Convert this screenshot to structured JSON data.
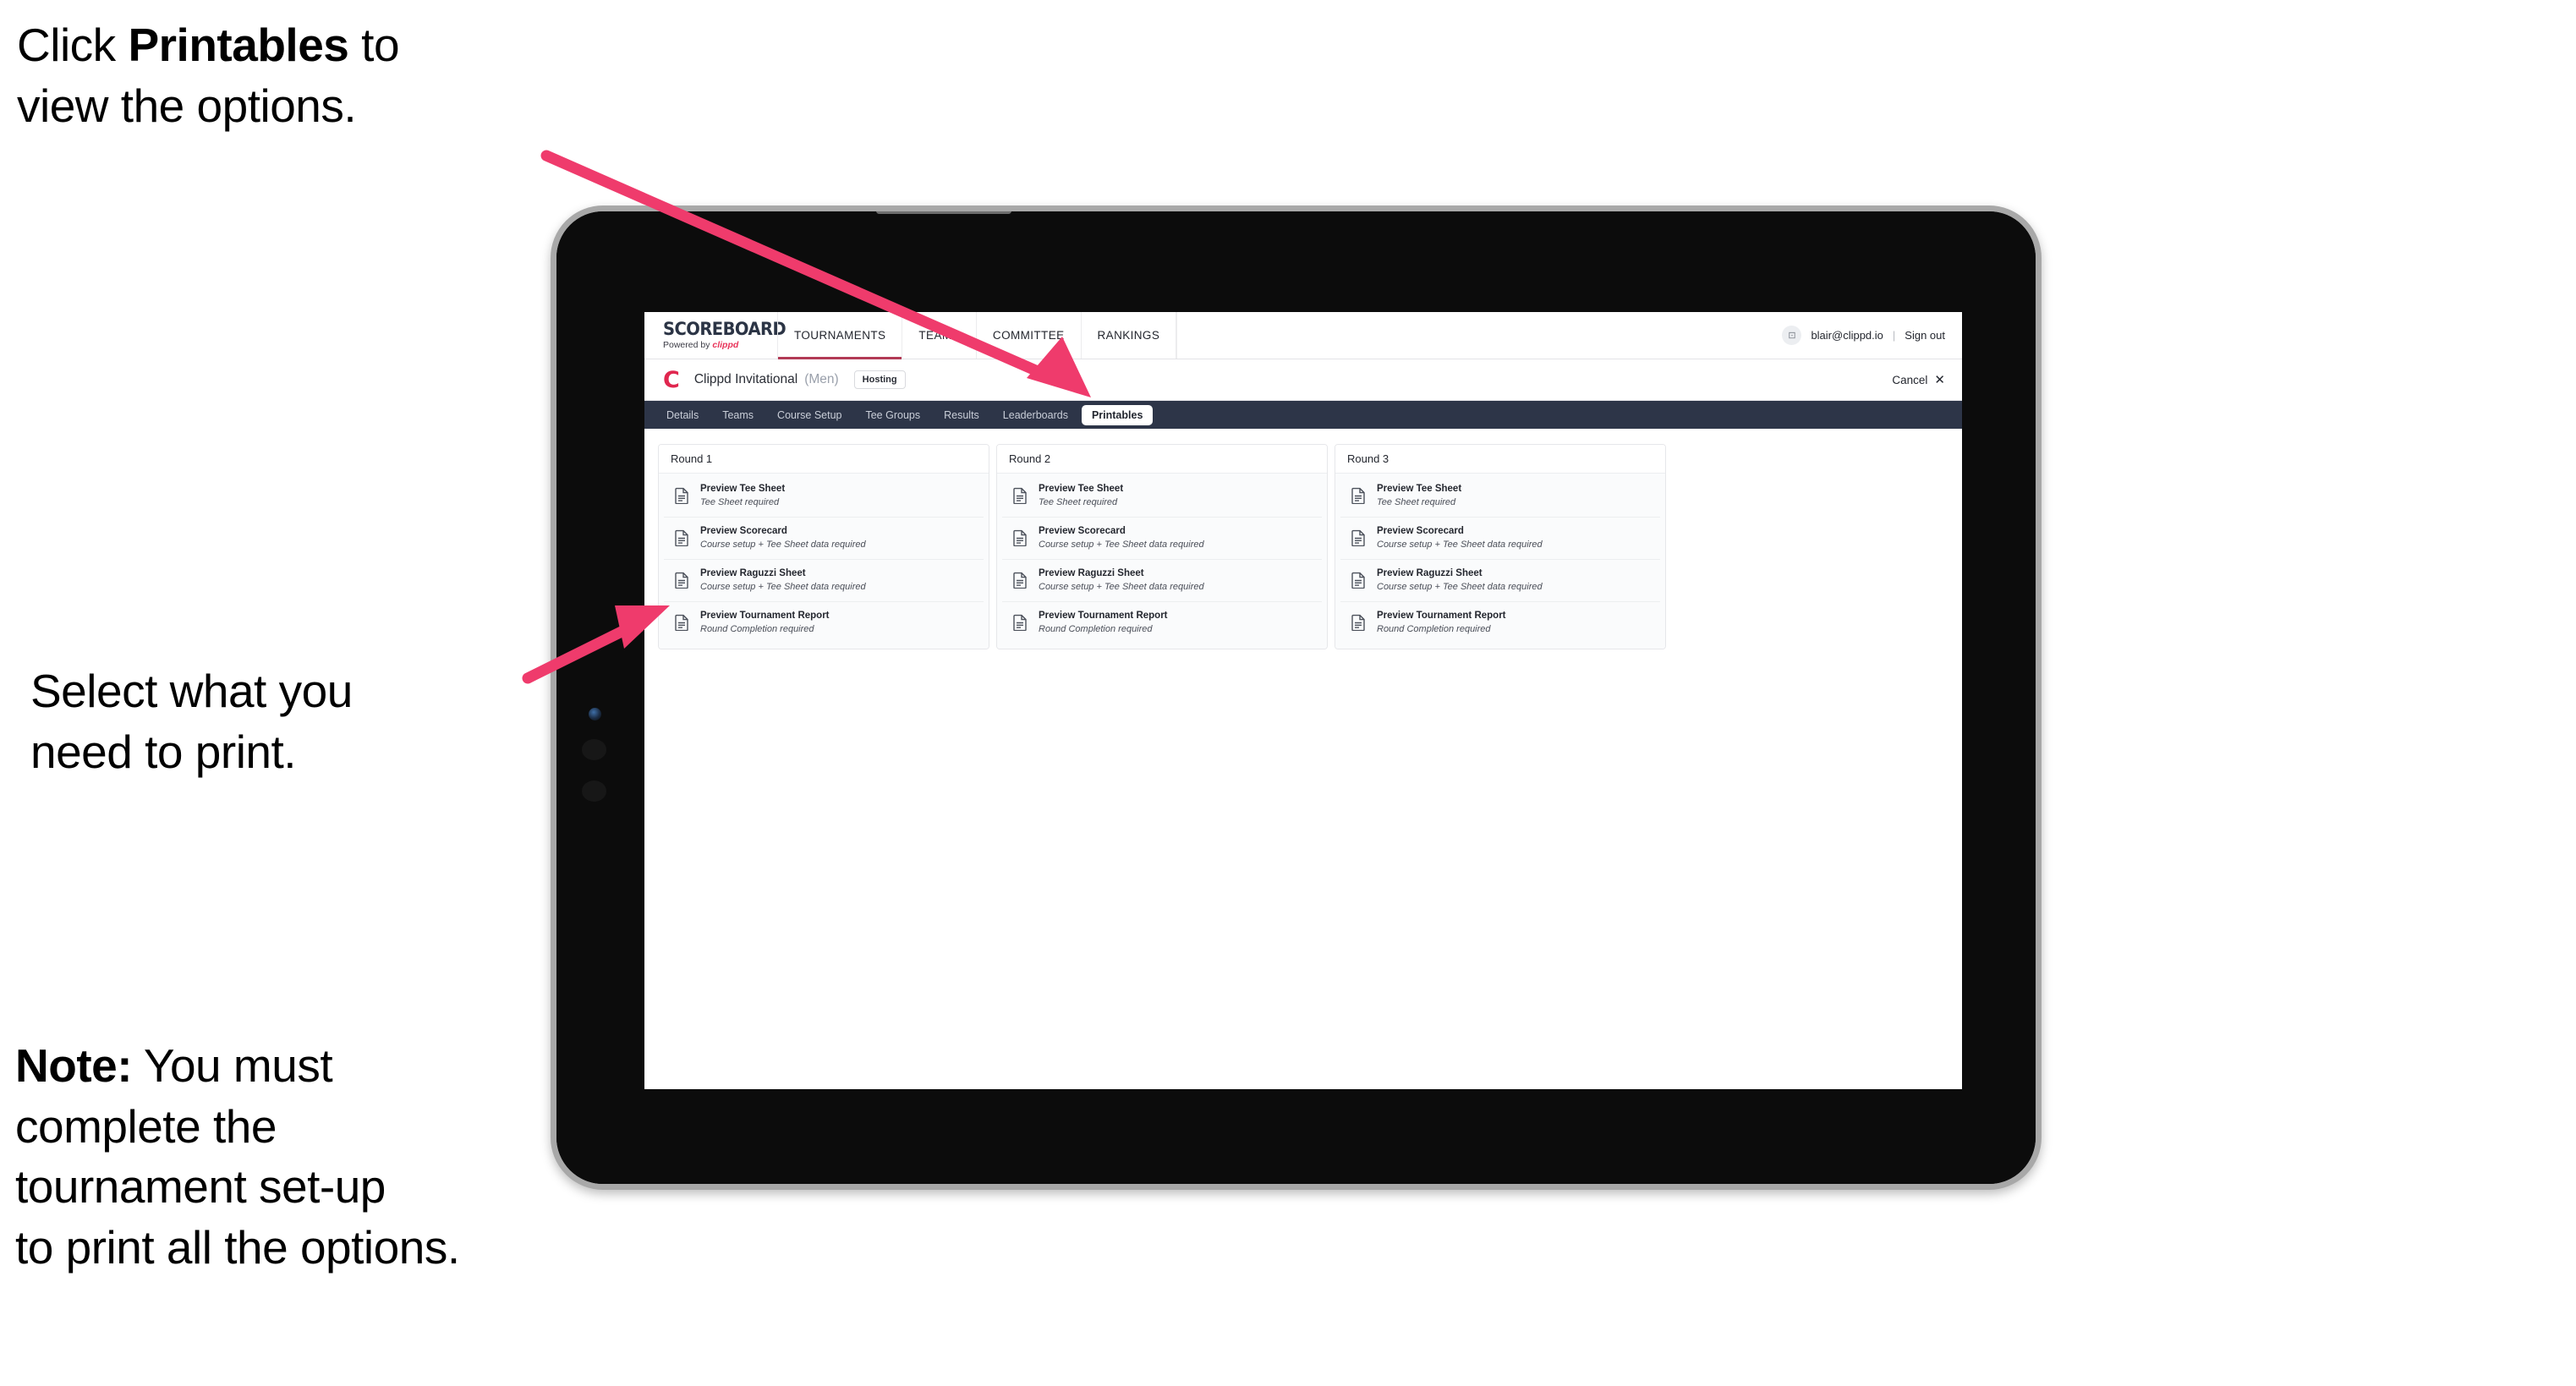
{
  "annotations": {
    "a1_pre": "Click ",
    "a1_bold": "Printables",
    "a1_post": " to\nview the options.",
    "a2": "Select what you\n need to print.",
    "a3_bold": "Note:",
    "a3_post": " You must\ncomplete the\ntournament set-up\nto print all the options."
  },
  "colors": {
    "accent_pink": "#ef3b6c",
    "brand_red": "#e0274f",
    "subtab_bar": "#2d3548",
    "nav_underline": "#b23a55"
  },
  "app": {
    "brand": {
      "word": "SCOREBOARD",
      "sub_prefix": "Powered by ",
      "sub_mark": "clippd"
    },
    "topnav": [
      {
        "label": "TOURNAMENTS",
        "active": true
      },
      {
        "label": "TEAMS",
        "active": false
      },
      {
        "label": "COMMITTEE",
        "active": false
      },
      {
        "label": "RANKINGS",
        "active": false
      }
    ],
    "user": {
      "avatar_glyph": "⊡",
      "email": "blair@clippd.io",
      "separator": "|",
      "signout": "Sign out"
    },
    "tournament": {
      "logo_letter": "C",
      "name": "Clippd Invitational",
      "gender": "(Men)",
      "badge": "Hosting",
      "cancel_label": "Cancel",
      "cancel_icon": "✕"
    },
    "subtabs": [
      {
        "label": "Details",
        "active": false
      },
      {
        "label": "Teams",
        "active": false
      },
      {
        "label": "Course Setup",
        "active": false
      },
      {
        "label": "Tee Groups",
        "active": false
      },
      {
        "label": "Results",
        "active": false
      },
      {
        "label": "Leaderboards",
        "active": false
      },
      {
        "label": "Printables",
        "active": true
      }
    ],
    "rounds": [
      {
        "title": "Round 1",
        "items": [
          {
            "title": "Preview Tee Sheet",
            "sub": "Tee Sheet required"
          },
          {
            "title": "Preview Scorecard",
            "sub": "Course setup + Tee Sheet data required"
          },
          {
            "title": "Preview Raguzzi Sheet",
            "sub": "Course setup + Tee Sheet data required"
          },
          {
            "title": "Preview Tournament Report",
            "sub": "Round Completion required"
          }
        ]
      },
      {
        "title": "Round 2",
        "items": [
          {
            "title": "Preview Tee Sheet",
            "sub": "Tee Sheet required"
          },
          {
            "title": "Preview Scorecard",
            "sub": "Course setup + Tee Sheet data required"
          },
          {
            "title": "Preview Raguzzi Sheet",
            "sub": "Course setup + Tee Sheet data required"
          },
          {
            "title": "Preview Tournament Report",
            "sub": "Round Completion required"
          }
        ]
      },
      {
        "title": "Round 3",
        "items": [
          {
            "title": "Preview Tee Sheet",
            "sub": "Tee Sheet required"
          },
          {
            "title": "Preview Scorecard",
            "sub": "Course setup + Tee Sheet data required"
          },
          {
            "title": "Preview Raguzzi Sheet",
            "sub": "Course setup + Tee Sheet data required"
          },
          {
            "title": "Preview Tournament Report",
            "sub": "Round Completion required"
          }
        ]
      }
    ]
  }
}
